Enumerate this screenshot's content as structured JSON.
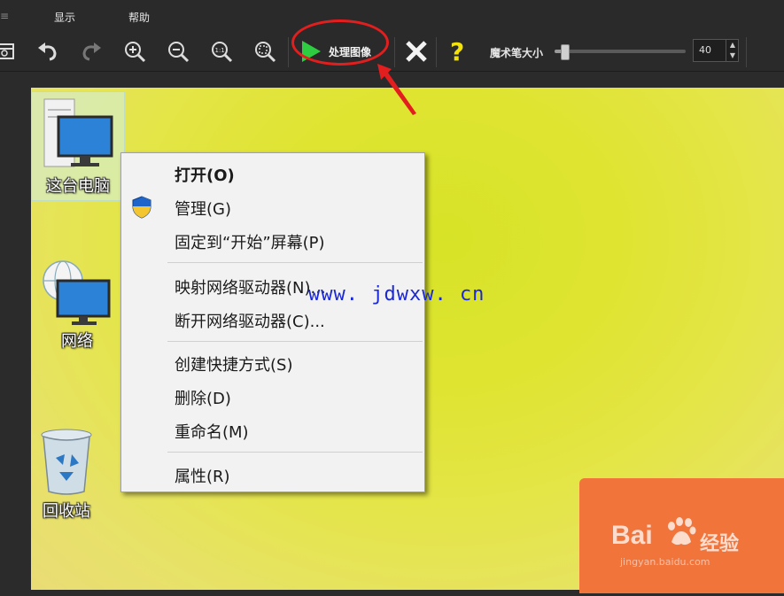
{
  "menu": {
    "items": [
      "显示",
      "帮助"
    ]
  },
  "toolbar": {
    "process_label": "处理图像",
    "help_glyph": "?",
    "brush_label": "魔术笔大小",
    "brush_value": "40",
    "brush_fraction": 0.06,
    "icons": [
      "open-icon",
      "undo-icon",
      "redo-icon",
      "zoom-in-icon",
      "zoom-out-icon",
      "actual-size-icon",
      "fit-icon",
      "play-icon",
      "close-icon",
      "help-icon"
    ]
  },
  "desktop": {
    "icons": [
      {
        "label": "这台电脑",
        "icon": "computer-icon"
      },
      {
        "label": "网络",
        "icon": "network-icon"
      },
      {
        "label": "回收站",
        "icon": "recycle-bin-icon"
      }
    ]
  },
  "context_menu": {
    "items": [
      {
        "label": "打开(O)",
        "bold": true
      },
      {
        "label": "管理(G)",
        "icon": "shield-icon"
      },
      {
        "label": "固定到“开始”屏幕(P)"
      },
      {
        "label": "映射网络驱动器(N)..."
      },
      {
        "label": "断开网络驱动器(C)..."
      },
      {
        "label": "创建快捷方式(S)"
      },
      {
        "label": "删除(D)"
      },
      {
        "label": "重命名(M)"
      },
      {
        "label": "属性(R)"
      }
    ]
  },
  "watermarks": {
    "site": "www. jdwxw. cn",
    "baidu": "Bai",
    "baidu_jingyan": "经验",
    "baidu_url": "jingyan.baidu.com"
  },
  "colors": {
    "accent_play": "#2ecc40",
    "highlight_circle": "#e21e1e",
    "help": "#f3e10a",
    "desktop": "#dfe431",
    "baidu_box": "#f1743b"
  }
}
